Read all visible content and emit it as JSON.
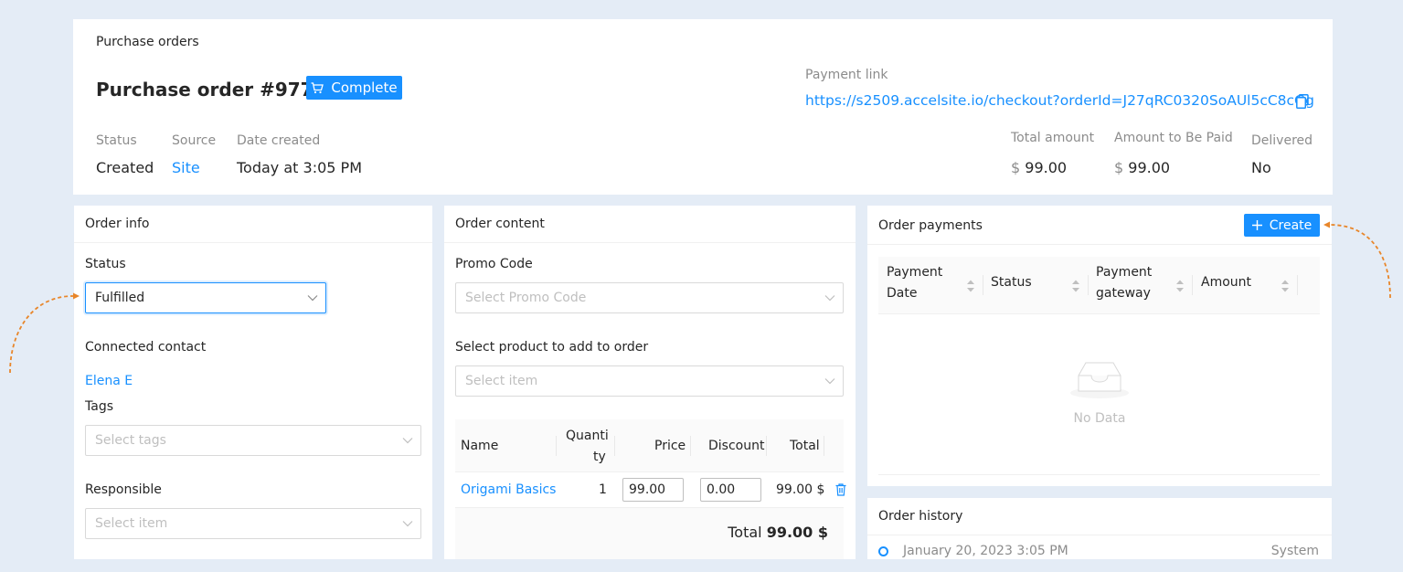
{
  "header": {
    "breadcrumb": "Purchase orders",
    "title": "Purchase order #97730",
    "complete_label": "Complete",
    "payment_link_label": "Payment link",
    "payment_link_url": "https://s2509.accelsite.io/checkout?orderId=J27qRC0320SoAUl5cC8cGg",
    "fields": {
      "status_label": "Status",
      "status_value": "Created",
      "source_label": "Source",
      "source_value": "Site",
      "date_label": "Date created",
      "date_value": "Today at 3:05 PM",
      "total_label": "Total amount",
      "total_currency": "$",
      "total_value": "99.00",
      "tobepaid_label": "Amount to Be Paid",
      "tobepaid_currency": "$",
      "tobepaid_value": "99.00",
      "delivered_label": "Delivered",
      "delivered_value": "No"
    }
  },
  "order_info": {
    "title": "Order info",
    "status_label": "Status",
    "status_value": "Fulfilled",
    "contact_label": "Connected contact",
    "contact_value": "Elena E",
    "tags_label": "Tags",
    "tags_placeholder": "Select tags",
    "responsible_label": "Responsible",
    "responsible_placeholder": "Select item"
  },
  "order_content": {
    "title": "Order content",
    "promo_label": "Promo Code",
    "promo_placeholder": "Select Promo Code",
    "product_label": "Select product to add to order",
    "product_placeholder": "Select item",
    "columns": {
      "name": "Name",
      "qty_1": "Quanti",
      "qty_2": "ty",
      "price": "Price",
      "discount": "Discount",
      "total": "Total"
    },
    "row": {
      "name": "Origami Basics",
      "qty": "1",
      "price": "99.00",
      "discount": "0.00",
      "total": "99.00 $"
    },
    "footer_label": "Total",
    "footer_value": "99.00 $"
  },
  "order_payments": {
    "title": "Order payments",
    "create_label": "Create",
    "columns": {
      "payment_date_1": "Payment",
      "payment_date_2": "Date",
      "status": "Status",
      "gateway_1": "Payment",
      "gateway_2": "gateway",
      "amount": "Amount"
    },
    "empty_text": "No Data"
  },
  "order_history": {
    "title": "Order history",
    "entry_date": "January 20, 2023 3:05 PM",
    "entry_author": "System"
  },
  "colors": {
    "page_bg": "#e4ecf6",
    "accent": "#1890ff",
    "annotation_arrow": "#e8862a"
  }
}
